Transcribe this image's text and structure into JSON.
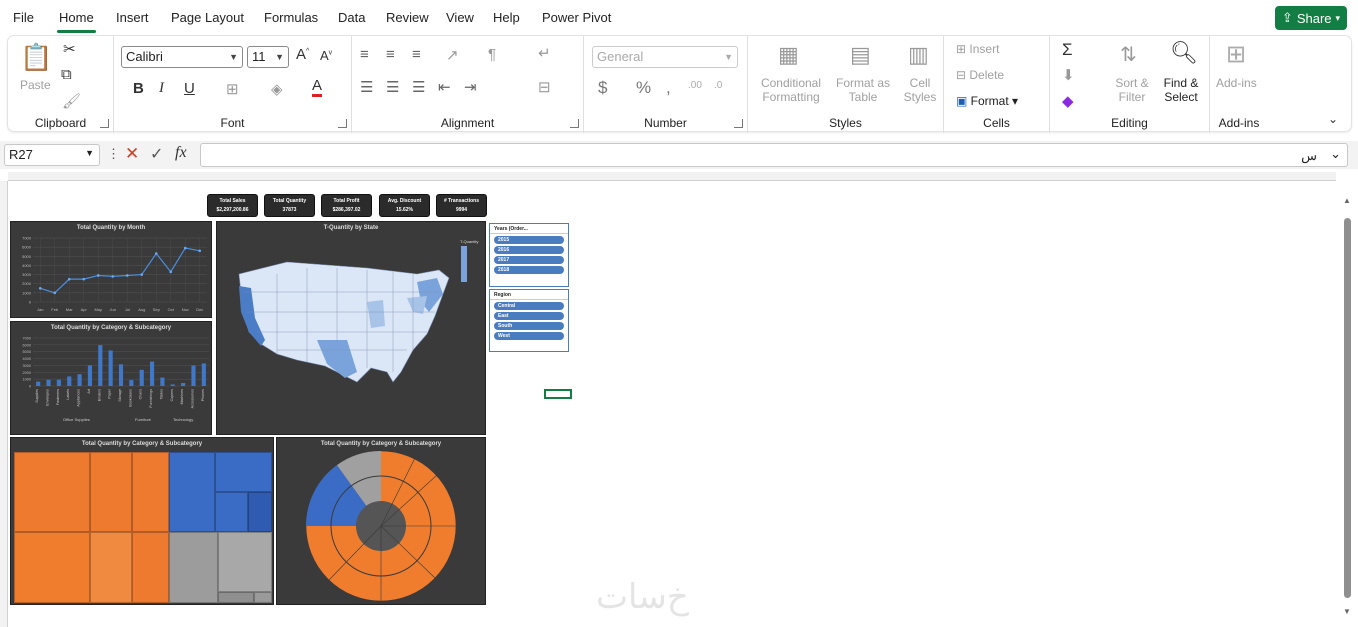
{
  "menu": {
    "tabs": [
      "File",
      "Home",
      "Insert",
      "Page Layout",
      "Formulas",
      "Data",
      "Review",
      "View",
      "Help",
      "Power Pivot"
    ],
    "active": "Home",
    "share": "Share"
  },
  "ribbon": {
    "clipboard": {
      "label": "Clipboard",
      "paste": "Paste"
    },
    "font": {
      "label": "Font",
      "name": "Calibri",
      "size": "11"
    },
    "alignment": {
      "label": "Alignment"
    },
    "number": {
      "label": "Number",
      "format": "General"
    },
    "styles": {
      "label": "Styles",
      "conditional": "Conditional",
      "conditional2": "Formatting",
      "format_as": "Format as",
      "format_as2": "Table",
      "cell": "Cell",
      "cell2": "Styles"
    },
    "cells": {
      "label": "Cells",
      "insert": "Insert",
      "delete": "Delete",
      "format": "Format"
    },
    "editing": {
      "label": "Editing",
      "sort": "Sort &",
      "sort2": "Filter",
      "find": "Find &",
      "find2": "Select"
    },
    "addins": {
      "label": "Add-ins",
      "btn": "Add-ins"
    }
  },
  "formula_bar": {
    "name_box": "R27",
    "content": "س"
  },
  "dashboard": {
    "kpis": [
      {
        "title": "Total Sales",
        "value": "$2,297,200.86"
      },
      {
        "title": "Total Quantity",
        "value": "37873"
      },
      {
        "title": "Total Profit",
        "value": "$286,397.02"
      },
      {
        "title": "Avg. Discount",
        "value": "15.62%"
      },
      {
        "title": "# Transactions",
        "value": "9994"
      }
    ],
    "line_title": "Total Quantity by Month",
    "bar_title": "Total Quantity by Category & Subcategory",
    "map_title": "T-Quantity by State",
    "map_legend": "T-Quantity",
    "treemap_title": "Total Quantity by Category & Subcategory",
    "sunburst_title": "Total Quantity by Category & Subcategory",
    "slicer_years": {
      "title": "Years (Order...",
      "items": [
        "2015",
        "2016",
        "2017",
        "2018"
      ]
    },
    "slicer_region": {
      "title": "Region",
      "items": [
        "Central",
        "East",
        "South",
        "West"
      ]
    },
    "bar_groups": [
      "Office Supplies",
      "Furniture",
      "Technology"
    ]
  },
  "chart_data": [
    {
      "type": "line",
      "title": "Total Quantity by Month",
      "categories": [
        "Jan",
        "Feb",
        "Mar",
        "Apr",
        "May",
        "Jun",
        "Jul",
        "Aug",
        "Sep",
        "Oct",
        "Nov",
        "Dec"
      ],
      "values": [
        1500,
        1000,
        2500,
        2500,
        2900,
        2800,
        2900,
        3000,
        5300,
        3300,
        5900,
        5600
      ],
      "ylim": [
        0,
        7000
      ],
      "yticks": [
        "0",
        "1000",
        "2000",
        "3000",
        "4000",
        "5000",
        "6000",
        "7000"
      ]
    },
    {
      "type": "bar",
      "title": "Total Quantity by Category & Subcategory",
      "categories": [
        "Supplies",
        "Envelopes",
        "Fasteners",
        "Labels",
        "Appliances",
        "Art",
        "Binders",
        "Paper",
        "Storage",
        "Bookcases",
        "Chairs",
        "Furnishings",
        "Tables",
        "Copiers",
        "Machines",
        "Accessories",
        "Phones"
      ],
      "values": [
        640,
        900,
        910,
        1400,
        1720,
        3000,
        5970,
        5180,
        3160,
        860,
        2360,
        3560,
        1240,
        230,
        440,
        2980,
        3290
      ],
      "ylim": [
        0,
        7000
      ]
    }
  ]
}
